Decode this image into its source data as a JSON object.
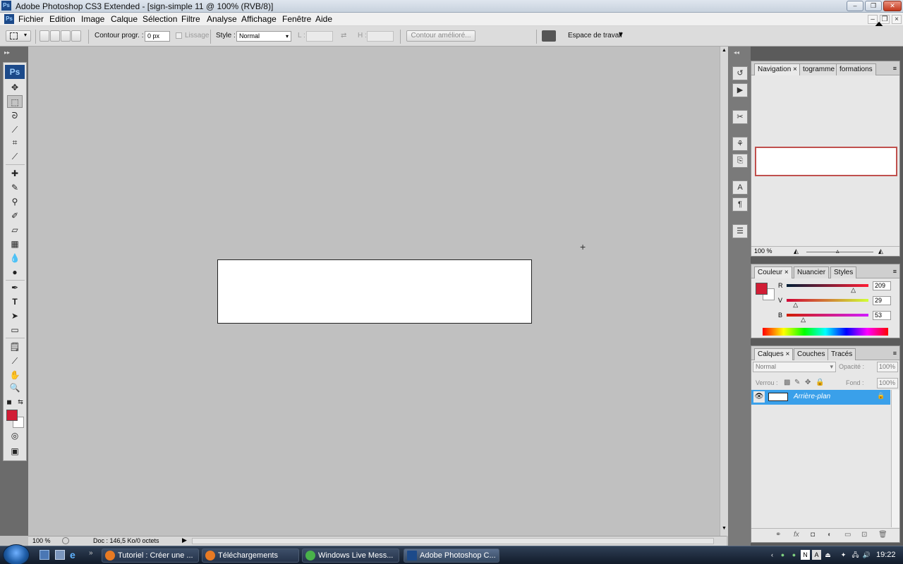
{
  "window": {
    "title": "Adobe Photoshop CS3 Extended - [sign-simple 11 @ 100% (RVB/8)]",
    "app_icon": "Ps"
  },
  "menubar": {
    "items": [
      "Fichier",
      "Edition",
      "Image",
      "Calque",
      "Sélection",
      "Filtre",
      "Analyse",
      "Affichage",
      "Fenêtre",
      "Aide"
    ]
  },
  "options": {
    "feather_label": "Contour progr. :",
    "feather_value": "0 px",
    "antialias_label": "Lissage",
    "style_label": "Style :",
    "style_value": "Normal",
    "width_label": "L :",
    "height_label": "H :",
    "refine_edge_label": "Contour amélioré...",
    "workspace_label": "Espace de travail"
  },
  "toolbox": {
    "badge": "Ps"
  },
  "status": {
    "zoom": "100 %",
    "doc_info": "Doc : 146,5 Ko/0 octets"
  },
  "navigator": {
    "tabs": [
      "Navigation",
      "togramme",
      "formations"
    ],
    "zoom": "100 %"
  },
  "color_panel": {
    "tabs": [
      "Couleur",
      "Nuancier",
      "Styles"
    ],
    "channels": [
      {
        "label": "R",
        "value": "209"
      },
      {
        "label": "V",
        "value": "29"
      },
      {
        "label": "B",
        "value": "53"
      }
    ],
    "foreground": "#d11d35",
    "background": "#ffffff"
  },
  "layers_panel": {
    "tabs": [
      "Calques",
      "Couches",
      "Tracés"
    ],
    "blend_mode": "Normal",
    "opacity_label": "Opacité :",
    "opacity_value": "100%",
    "lock_label": "Verrou :",
    "fill_label": "Fond :",
    "fill_value": "100%",
    "layers": [
      {
        "name": "Arrière-plan"
      }
    ]
  },
  "taskbar": {
    "buttons": [
      {
        "label": "Tutoriel : Créer une ..."
      },
      {
        "label": "Téléchargements"
      },
      {
        "label": "Windows Live Mess..."
      },
      {
        "label": "Adobe Photoshop C..."
      }
    ],
    "clock": "19:22"
  },
  "colors": {
    "accent": "#3aa0ea",
    "foreground_swatch": "#d11d35"
  }
}
